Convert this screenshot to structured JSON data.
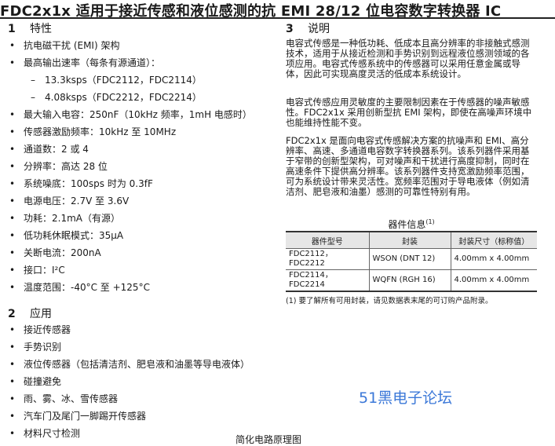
{
  "title": "FDC2x1x 适用于接近传感和液位感测的抗 EMI 28/12 位电容数字转换器 IC",
  "features": {
    "number": "1",
    "heading": "特性",
    "items": [
      {
        "text": "抗电磁干扰 (EMI) 架构",
        "level": 0
      },
      {
        "text": "最高输出速率（每条有源通道）：",
        "level": 0
      },
      {
        "text": "13.3ksps（FDC2112，FDC2114）",
        "level": 1
      },
      {
        "text": "4.08ksps（FDC2212，FDC2214）",
        "level": 1
      },
      {
        "text": "最大输入电容：250nF（10kHz 频率，1mH 电感时）",
        "level": 0
      },
      {
        "text": "传感器激励频率：10kHz 至 10MHz",
        "level": 0
      },
      {
        "text": "通道数：2 或 4",
        "level": 0
      },
      {
        "text": "分辨率：高达 28 位",
        "level": 0
      },
      {
        "text": "系统噪底：100sps 时为 0.3fF",
        "level": 0
      },
      {
        "text": "电源电压：2.7V 至 3.6V",
        "level": 0
      },
      {
        "text": "功耗：2.1mA（有源）",
        "level": 0
      },
      {
        "text": "低功耗休眠模式：35μA",
        "level": 0
      },
      {
        "text": "关断电流：200nA",
        "level": 0
      },
      {
        "text": "接口：I²C",
        "level": 0
      },
      {
        "text": "温度范围：-40°C 至 +125°C",
        "level": 0
      }
    ]
  },
  "applications": {
    "number": "2",
    "heading": "应用",
    "items": [
      "接近传感器",
      "手势识别",
      "液位传感器（包括清洁剂、肥皂液和油墨等导电液体）",
      "碰撞避免",
      "雨、雾、冰、雪传感器",
      "汽车门及尾门一脚踢开传感器",
      "材料尺寸检测"
    ]
  },
  "description": {
    "number": "3",
    "heading": "说明",
    "paragraphs": [
      "电容式传感是一种低功耗、低成本且高分辨率的非接触式感测技术，适用于从接近检测和手势识别到远程液位感测领域的各项应用。电容式传感系统中的传感器可以采用任意金属或导体，因此可实现高度灵活的低成本系统设计。",
      "电容式传感应用灵敏度的主要限制因素在于传感器的噪声敏感性。FDC2x1x 采用创新型抗 EMI 架构，即使在高噪声环境中也能维持性能不变。",
      "FDC2x1x 是面向电容式传感解决方案的抗噪声和 EMI、高分辨率、高速、多通道电容数字转换器系列。该系列器件采用基于窄带的创新型架构，可对噪声和干扰进行高度抑制，同时在高速条件下提供高分辨率。该系列器件支持宽激励频率范围，可为系统设计带来灵活性。宽频率范围对于导电液体（例如清洁剂、肥皂液和油墨）感测的可靠性特别有用。"
    ]
  },
  "device_table": {
    "caption": "器件信息",
    "caption_note": "(1)",
    "headers": [
      "器件型号",
      "封装",
      "封装尺寸（标称值）"
    ],
    "rows": [
      [
        "FDC2112，FDC2212",
        "WSON (DNT 12)",
        "4.00mm x 4.00mm"
      ],
      [
        "FDC2114，FDC2214",
        "WQFN (RGH 16)",
        "4.00mm x 4.00mm"
      ]
    ],
    "footnote": "(1) 要了解所有可用封装，请见数据表末尾的可订购产品附录。"
  },
  "watermark": "51黑电子论坛",
  "bottom_text": "简化电路原理图",
  "colors": {
    "watermark": "#3b78d8",
    "table_header_bg": "#e6e6e6"
  }
}
